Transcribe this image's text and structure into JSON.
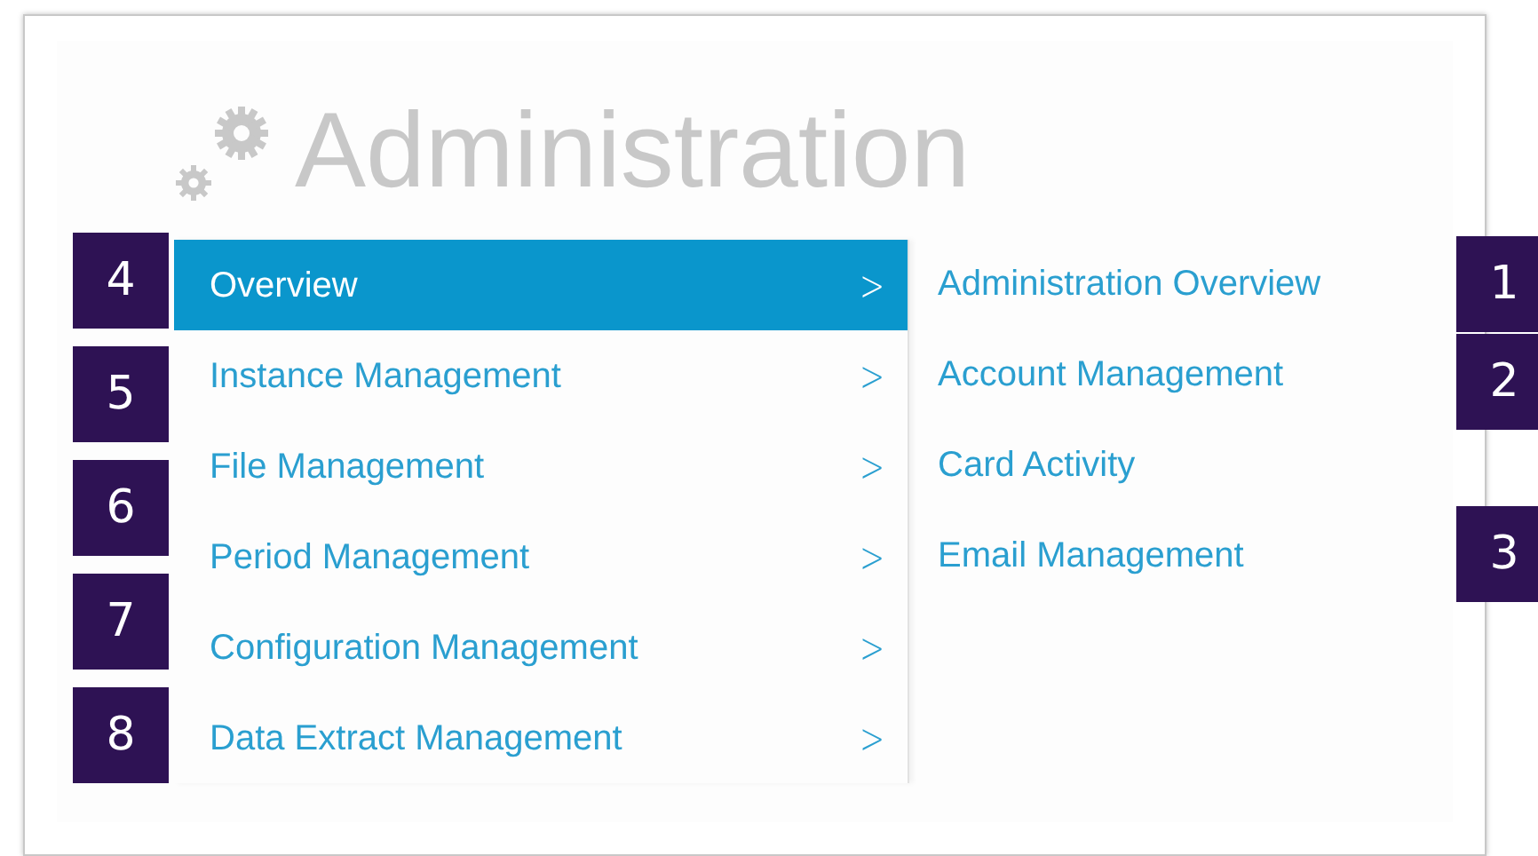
{
  "title": "Administration",
  "menu": [
    {
      "label": "Overview",
      "selected": true,
      "chevron": ">"
    },
    {
      "label": "Instance Management",
      "selected": false,
      "chevron": ">"
    },
    {
      "label": "File Management",
      "selected": false,
      "chevron": ">"
    },
    {
      "label": "Period Management",
      "selected": false,
      "chevron": ">"
    },
    {
      "label": "Configuration Management",
      "selected": false,
      "chevron": ">"
    },
    {
      "label": "Data Extract Management",
      "selected": false,
      "chevron": ">"
    }
  ],
  "submenu": [
    {
      "label": "Administration Overview"
    },
    {
      "label": "Account Management"
    },
    {
      "label": "Card Activity"
    },
    {
      "label": "Email Management"
    }
  ],
  "left_callouts": [
    {
      "label": "4"
    },
    {
      "label": "5"
    },
    {
      "label": "6"
    },
    {
      "label": "7"
    },
    {
      "label": "8"
    }
  ],
  "right_callouts": [
    {
      "label": "1"
    },
    {
      "label": "2"
    },
    {
      "label": "3"
    }
  ]
}
